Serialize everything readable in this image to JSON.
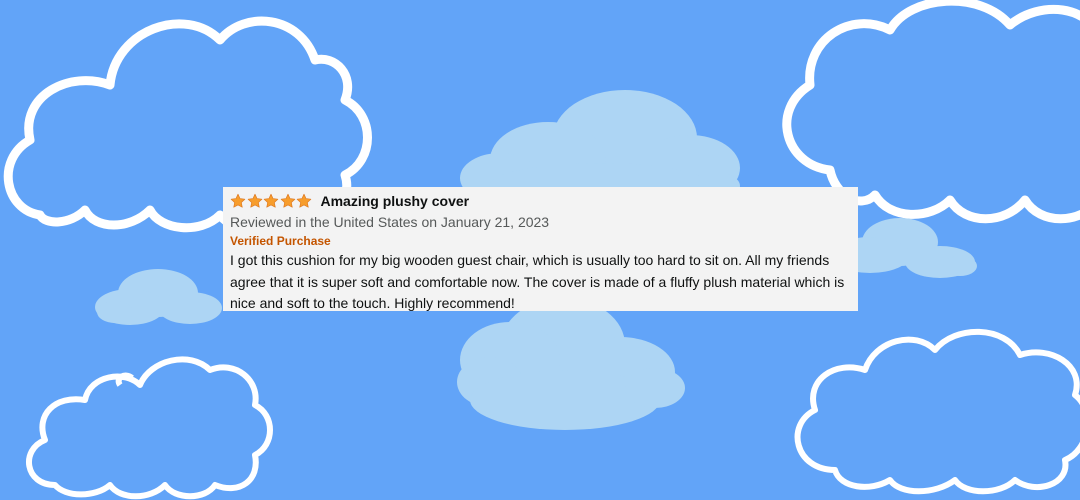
{
  "colors": {
    "sky": "#62a4f8",
    "cloud_fill": "#add5f4",
    "cloud_outline": "#ffffff",
    "star": "#f79d2c",
    "verified": "#c45500",
    "card": "#f3f3f3"
  },
  "review": {
    "rating": 5,
    "rating_max": 5,
    "star_icon": "star-icon",
    "title": "Amazing plushy cover",
    "meta": "Reviewed in the United States on January 21, 2023",
    "verified_label": "Verified Purchase",
    "body": "I got this cushion for my big wooden guest chair, which is usually too hard to sit on. All my friends agree that it is super soft and comfortable now. The cover is made of a fluffy plush material which is nice and soft to the touch. Highly recommend!"
  }
}
